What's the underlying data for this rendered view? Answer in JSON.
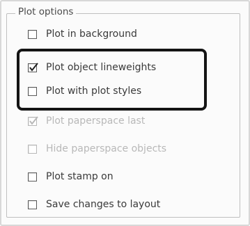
{
  "group": {
    "title": "Plot options"
  },
  "options": [
    {
      "label": "Plot in background",
      "checked": false,
      "enabled": true
    },
    {
      "label": "Plot object lineweights",
      "checked": true,
      "enabled": true
    },
    {
      "label": "Plot with plot styles",
      "checked": false,
      "enabled": true
    },
    {
      "label": "Plot paperspace last",
      "checked": true,
      "enabled": false
    },
    {
      "label": "Hide paperspace objects",
      "checked": false,
      "enabled": false
    },
    {
      "label": "Plot stamp on",
      "checked": false,
      "enabled": true
    },
    {
      "label": "Save changes to layout",
      "checked": false,
      "enabled": true
    }
  ],
  "colors": {
    "highlight_border": "#141414",
    "disabled_text": "#b8b8b8",
    "text": "#3a3a3a"
  }
}
